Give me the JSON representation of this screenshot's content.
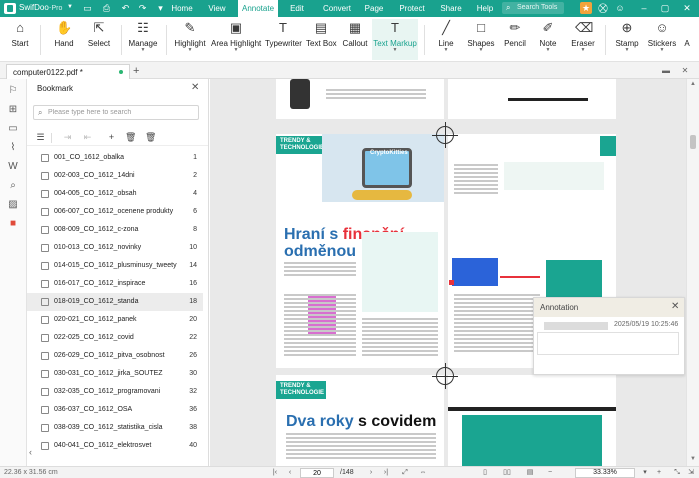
{
  "app": {
    "name": "SwifDoo",
    "edition": "Pro"
  },
  "menu": {
    "items": [
      "Home",
      "View",
      "Annotate",
      "Edit",
      "Convert",
      "Page",
      "Protect",
      "Share",
      "Help"
    ],
    "active": "Annotate",
    "search_placeholder": "Search Tools"
  },
  "ribbon": {
    "tools": [
      {
        "label": "Start",
        "icon": "home-icon"
      },
      {
        "label": "Hand",
        "icon": "hand-icon"
      },
      {
        "label": "Select",
        "icon": "cursor-icon"
      },
      {
        "label": "Manage",
        "icon": "manage-icon"
      },
      {
        "label": "Highlight",
        "icon": "highlight-icon"
      },
      {
        "label": "Area Highlight",
        "icon": "area-highlight-icon"
      },
      {
        "label": "Typewriter",
        "icon": "typewriter-icon"
      },
      {
        "label": "Text Box",
        "icon": "textbox-icon"
      },
      {
        "label": "Callout",
        "icon": "callout-icon"
      },
      {
        "label": "Text Markup",
        "icon": "text-markup-icon"
      },
      {
        "label": "Line",
        "icon": "line-icon"
      },
      {
        "label": "Shapes",
        "icon": "shapes-icon"
      },
      {
        "label": "Pencil",
        "icon": "pencil-icon"
      },
      {
        "label": "Note",
        "icon": "note-icon"
      },
      {
        "label": "Eraser",
        "icon": "eraser-icon"
      },
      {
        "label": "Stamp",
        "icon": "stamp-icon"
      },
      {
        "label": "Stickers",
        "icon": "stickers-icon"
      },
      {
        "label": "A",
        "icon": "more-icon"
      }
    ]
  },
  "tab": {
    "filename": "computer0122.pdf *"
  },
  "bookmark_panel": {
    "title": "Bookmark",
    "search_placeholder": "Please type here to search",
    "items": [
      {
        "name": "001_CO_1612_obalka",
        "page": "1"
      },
      {
        "name": "002-003_CO_1612_14dni",
        "page": "2"
      },
      {
        "name": "004-005_CO_1612_obsah",
        "page": "4"
      },
      {
        "name": "006-007_CO_1612_ocenene produkty",
        "page": "6"
      },
      {
        "name": "008-009_CO_1612_c-zona",
        "page": "8"
      },
      {
        "name": "010-013_CO_1612_novinky",
        "page": "10"
      },
      {
        "name": "014-015_CO_1612_plusminusy_tweety",
        "page": "14"
      },
      {
        "name": "016-017_CO_1612_inspirace",
        "page": "16"
      },
      {
        "name": "018-019_CO_1612_standa",
        "page": "18"
      },
      {
        "name": "020-021_CO_1612_panek",
        "page": "20"
      },
      {
        "name": "022-025_CO_1612_covid",
        "page": "22"
      },
      {
        "name": "026-029_CO_1612_pitva_osobnost",
        "page": "26"
      },
      {
        "name": "030-031_CO_1612_jirka_SOUTEZ",
        "page": "30"
      },
      {
        "name": "032-035_CO_1612_programovani",
        "page": "32"
      },
      {
        "name": "036-037_CO_1612_OSA",
        "page": "36"
      },
      {
        "name": "038-039_CO_1612_statistika_cisla",
        "page": "38"
      },
      {
        "name": "040-041_CO_1612_elektrosvet",
        "page": "40"
      }
    ],
    "selected_index": 8
  },
  "document": {
    "page1": {
      "section": "TRENDY & TECHNOLOGIE",
      "title_part1": "Hraní s ",
      "title_highlight": "finanční",
      "title_part2": "odměnou",
      "banner": "CryptoKitties"
    },
    "page2": {
      "section": "TRENDY & TECHNOLOGIE",
      "title_part1": "Dva roky ",
      "title_highlight": "s covidem"
    }
  },
  "annotation": {
    "title": "Annotation",
    "timestamp": "2025/05/19 10:25:46"
  },
  "status": {
    "page_size": "22.36 x 31.56 cm",
    "current_page": "20",
    "total_pages": "/148",
    "zoom": "33.33%"
  },
  "colors": {
    "brand": "#19a28e",
    "accent_red": "#e8313b",
    "title_blue": "#2a6fb0"
  }
}
